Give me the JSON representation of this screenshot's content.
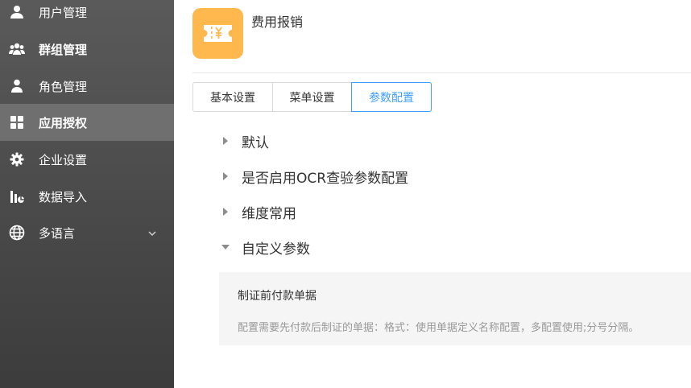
{
  "sidebar": {
    "items": [
      {
        "label": "用户管理",
        "icon": "user-icon"
      },
      {
        "label": "群组管理",
        "icon": "group-icon"
      },
      {
        "label": "角色管理",
        "icon": "role-icon"
      },
      {
        "label": "应用授权",
        "icon": "grid-icon"
      },
      {
        "label": "企业设置",
        "icon": "gear-icon"
      },
      {
        "label": "数据导入",
        "icon": "bar-chart-icon"
      },
      {
        "label": "多语言",
        "icon": "globe-icon"
      }
    ],
    "active_item": "应用授权"
  },
  "header": {
    "app_title": "费用报销",
    "app_icon": "ticket-yen-icon",
    "app_icon_color": "#ffb84d"
  },
  "tabs": [
    {
      "label": "基本设置"
    },
    {
      "label": "菜单设置"
    },
    {
      "label": "参数配置"
    }
  ],
  "active_tab": "参数配置",
  "tree": {
    "nodes": [
      {
        "label": "默认",
        "expanded": false
      },
      {
        "label": "是否启用OCR查验参数配置",
        "expanded": false
      },
      {
        "label": "维度常用",
        "expanded": false
      },
      {
        "label": "自定义参数",
        "expanded": true
      }
    ]
  },
  "param": {
    "title": "制证前付款单据",
    "description": "配置需要先付款后制证的单据：格式：使用单据定义名称配置，多配置使用;分号分隔。"
  },
  "colors": {
    "accent": "#409eff",
    "sidebar_active": "#6f6f6f"
  }
}
